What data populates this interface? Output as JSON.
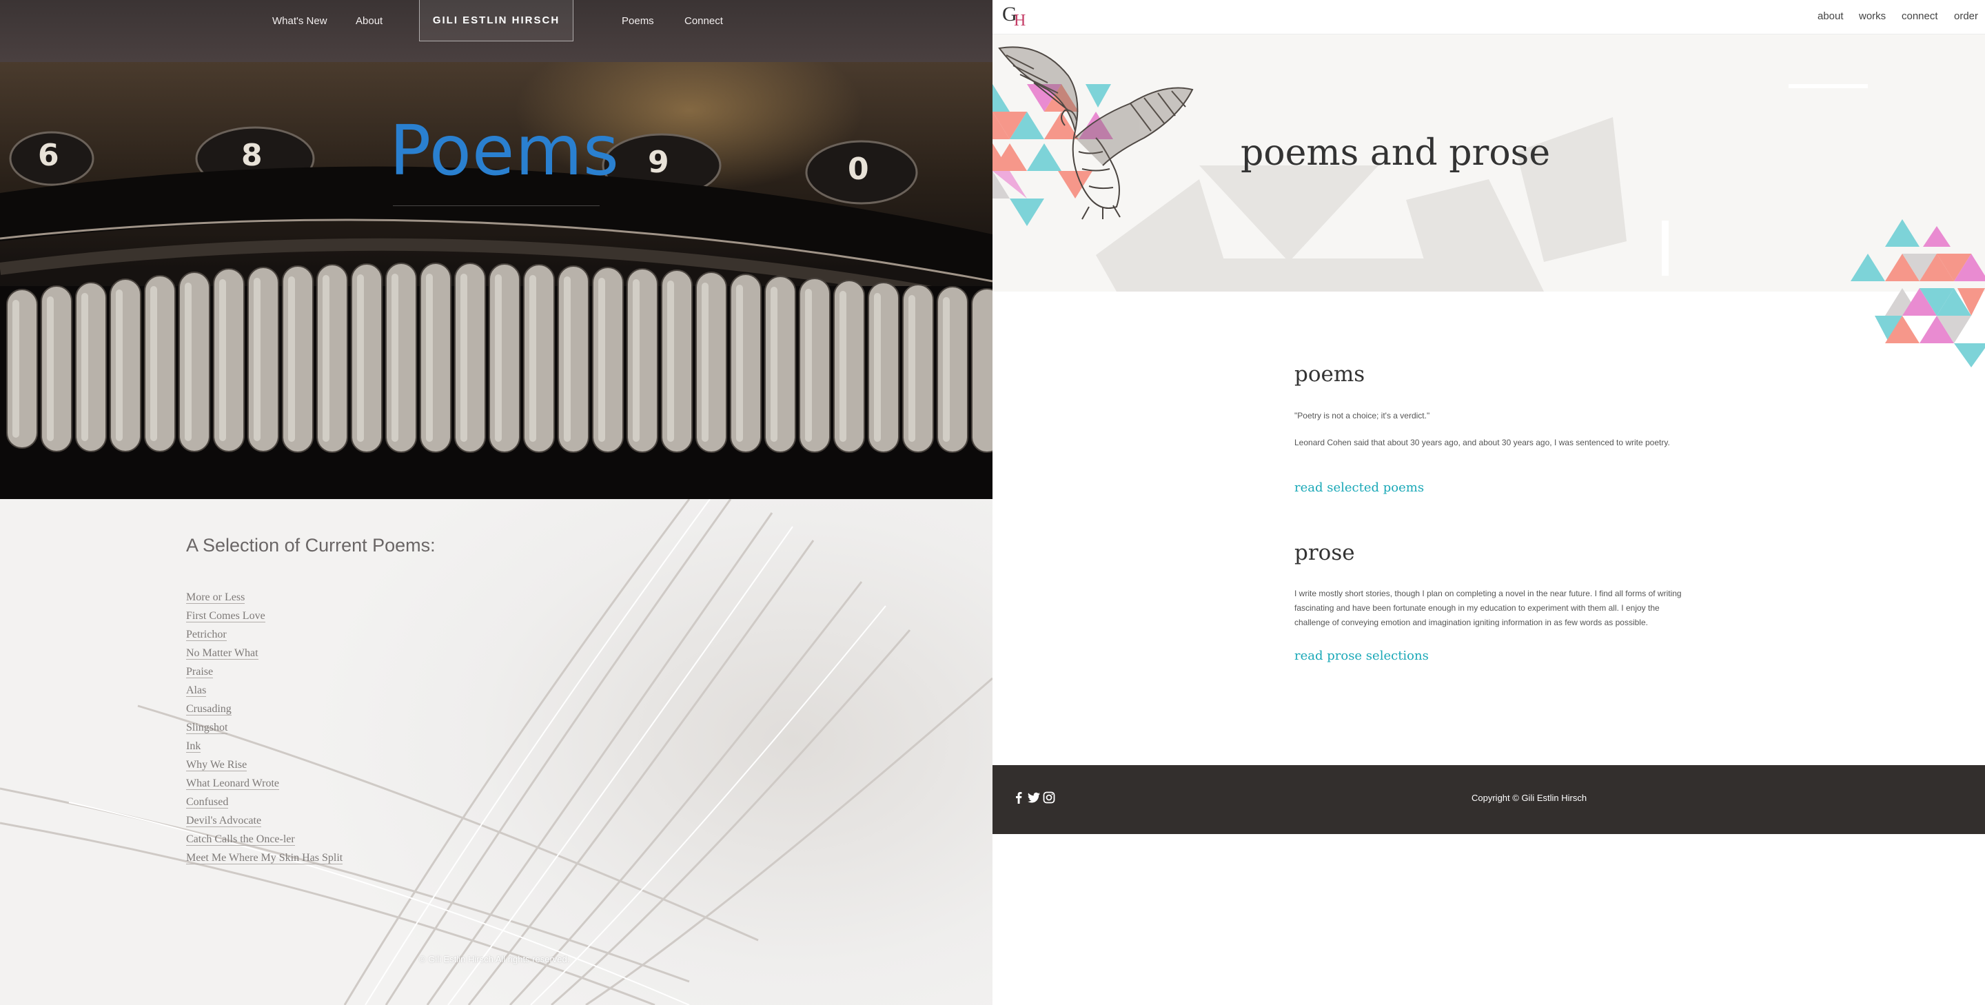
{
  "left": {
    "nav": {
      "whats_new": "What's New",
      "about": "About",
      "brand": "GILI ESTLIN HIRSCH",
      "poems": "Poems",
      "connect": "Connect"
    },
    "hero_title": "Poems",
    "heading": "A Selection of Current Poems:",
    "poems": [
      "More or Less",
      "First Comes Love",
      "Petrichor",
      "No Matter What",
      "Praise",
      "Alas",
      "Crusading",
      "Slingshot",
      "Ink",
      "Why We Rise",
      "What Leonard Wrote",
      "Confused",
      "Devil's Advocate",
      "Catch Calls the Once-ler",
      "Meet Me Where My Skin Has Split"
    ],
    "copyright": "© Gili Estlin Hirsch All rights reserved."
  },
  "right": {
    "logo": {
      "g": "G",
      "h": "H"
    },
    "nav": {
      "about": "about",
      "works": "works",
      "connect": "connect",
      "order": "order"
    },
    "banner_title": "poems and prose",
    "poems_section": {
      "title": "poems",
      "quote": "\"Poetry is not a choice; it's a verdict.\"",
      "text": "Leonard Cohen said that about 30 years ago, and about 30 years ago, I was sentenced to write poetry.",
      "link": "read selected poems"
    },
    "prose_section": {
      "title": "prose",
      "text_lines": [
        "I write mostly short stories, though I plan on completing a novel in the near future. I find all forms of writing",
        "fascinating and have been fortunate enough in my education to experiment with them all. I enjoy the",
        "challenge of conveying emotion and imagination igniting information in as few words as possible."
      ],
      "link": "read prose selections"
    },
    "footer": {
      "icons": [
        "facebook-icon",
        "twitter-icon",
        "instagram-icon"
      ],
      "copyright": "Copyright © Gili Estlin Hirsch"
    }
  },
  "colors": {
    "hero_title": "#2a80d0",
    "link_teal": "#1aa8b7",
    "footer_bg": "#332f2d",
    "triangle_teal": "#7dd3d8",
    "triangle_pink": "#e98bd1",
    "triangle_coral": "#f6978a",
    "triangle_gray": "#d6d3d3"
  }
}
